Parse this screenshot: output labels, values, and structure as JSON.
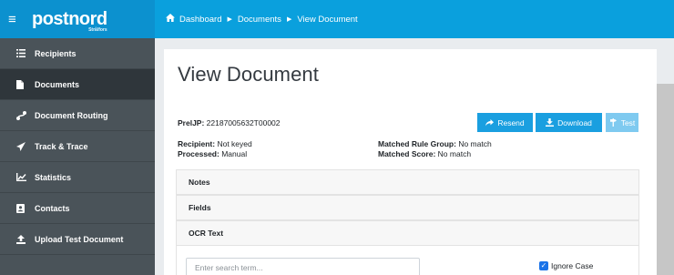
{
  "brand": {
    "logo_text": "postnord",
    "logo_subtext": "Strålfors"
  },
  "breadcrumb": [
    "Dashboard",
    "Documents",
    "View Document"
  ],
  "sidebar": {
    "items": [
      {
        "label": "Recipients",
        "icon": "list-icon"
      },
      {
        "label": "Documents",
        "icon": "file-icon",
        "active": true
      },
      {
        "label": "Document Routing",
        "icon": "routing-icon"
      },
      {
        "label": "Track & Trace",
        "icon": "paper-plane-icon"
      },
      {
        "label": "Statistics",
        "icon": "chart-icon"
      },
      {
        "label": "Contacts",
        "icon": "contact-card-icon"
      },
      {
        "label": "Upload Test Document",
        "icon": "upload-icon"
      }
    ]
  },
  "page": {
    "title": "View Document",
    "prelijp_label": "PrelJP:",
    "prelijp_value": "22187005632T00002",
    "buttons": {
      "resend": "Resend",
      "download": "Download",
      "test": "Test"
    },
    "recipient_label": "Recipient:",
    "recipient_value": "Not keyed",
    "processed_label": "Processed:",
    "processed_value": "Manual",
    "matched_rule_label": "Matched Rule Group:",
    "matched_rule_value": "No match",
    "matched_score_label": "Matched Score:",
    "matched_score_value": "No match",
    "sections": [
      "Notes",
      "Fields",
      "OCR Text"
    ],
    "search_placeholder": "Enter search term...",
    "ignore_case_label": "Ignore Case",
    "ignore_case_checked": true
  },
  "colors": {
    "brand_blue": "#0c91cf",
    "breadcrumb_blue": "#0aa0dd",
    "sidebar": "#4a5359",
    "button": "#1a9fe0"
  }
}
